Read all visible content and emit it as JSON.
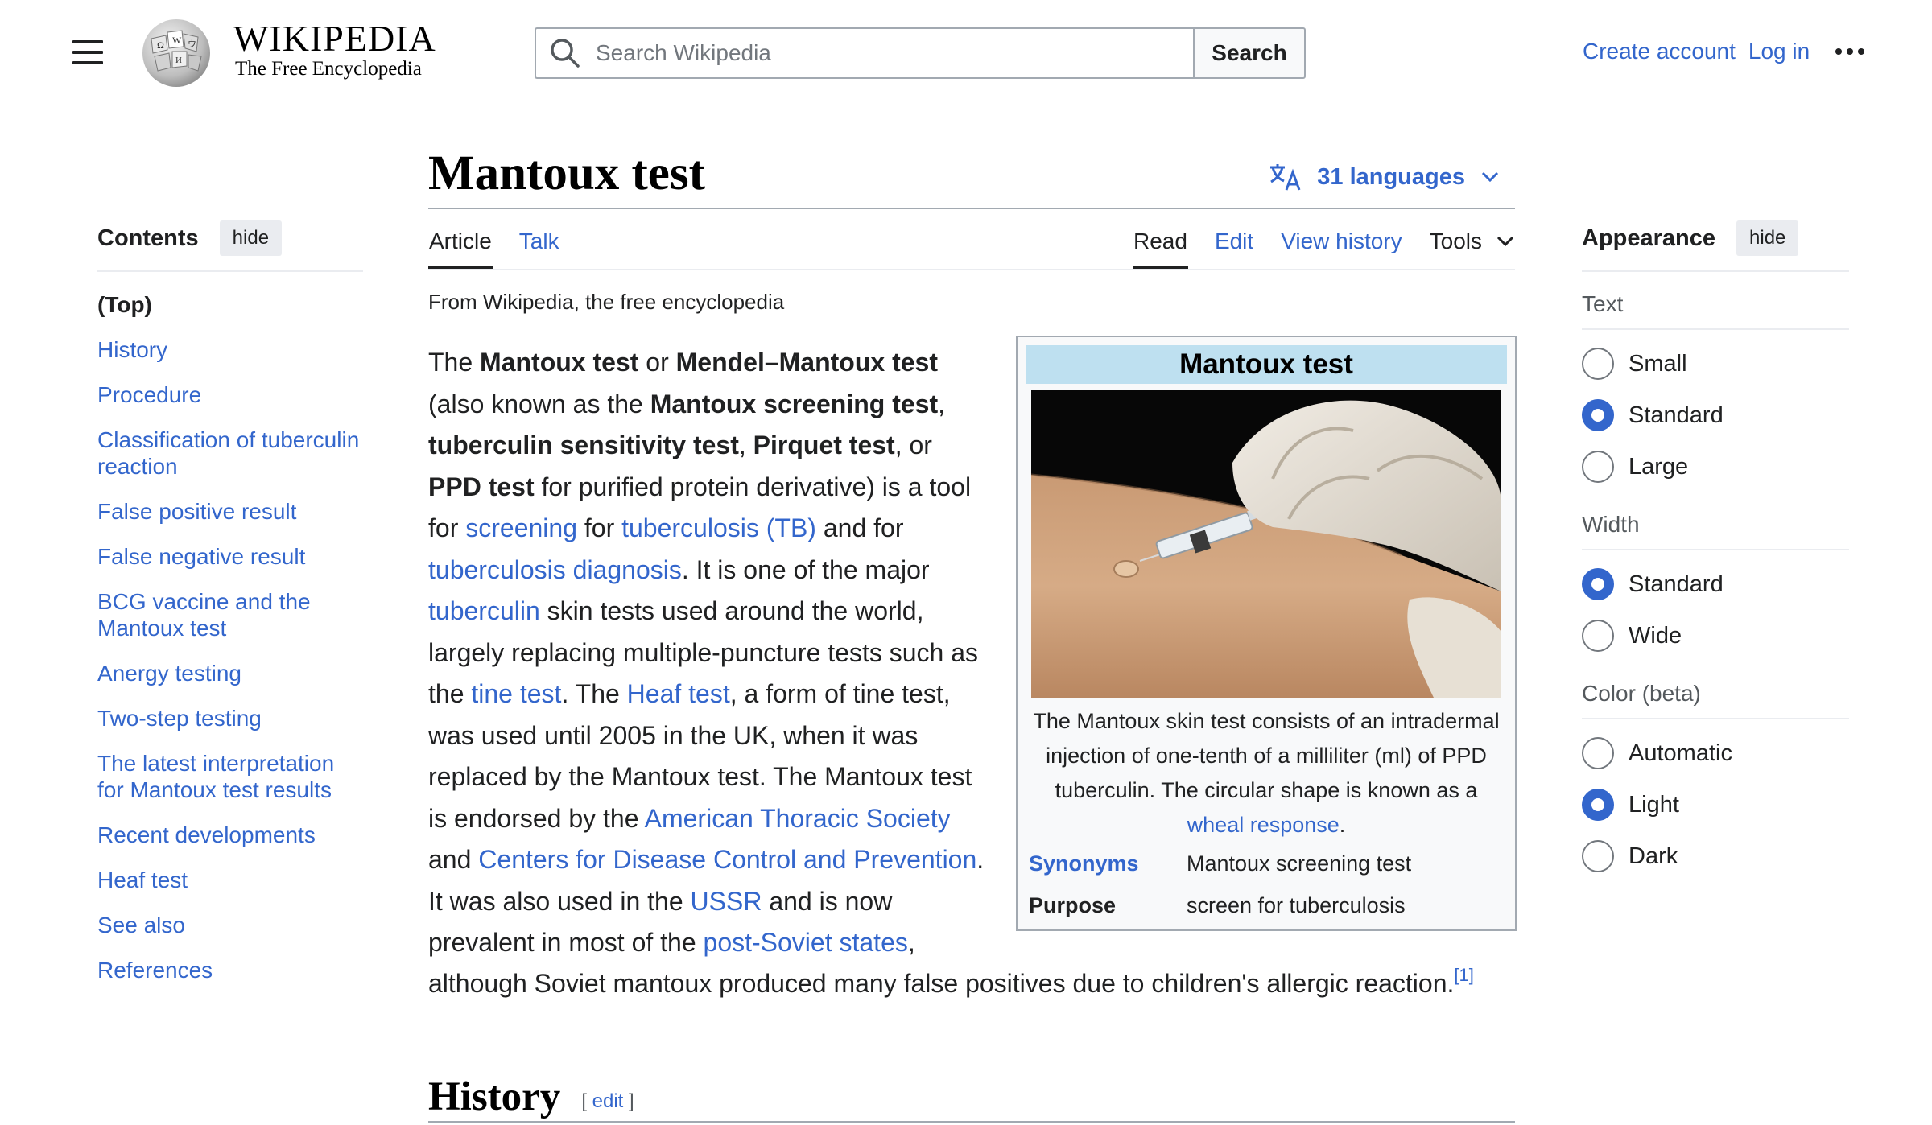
{
  "header": {
    "logo_title": "WIKIPEDIA",
    "logo_tagline": "The Free Encyclopedia",
    "search_placeholder": "Search Wikipedia",
    "search_button": "Search",
    "create_account": "Create account",
    "log_in": "Log in"
  },
  "toc": {
    "title": "Contents",
    "hide": "hide",
    "items": [
      "(Top)",
      "History",
      "Procedure",
      "Classification of tuberculin reaction",
      "False positive result",
      "False negative result",
      "BCG vaccine and the Mantoux test",
      "Anergy testing",
      "Two-step testing",
      "The latest interpretation for Mantoux test results",
      "Recent developments",
      "Heaf test",
      "See also",
      "References"
    ]
  },
  "page": {
    "title": "Mantoux test",
    "languages": "31 languages",
    "tabs": {
      "article": "Article",
      "talk": "Talk",
      "read": "Read",
      "edit": "Edit",
      "history": "View history",
      "tools": "Tools"
    },
    "tagline": "From Wikipedia, the free encyclopedia"
  },
  "intro": {
    "t1": "The ",
    "b1": "Mantoux test",
    "t2": " or ",
    "b2": "Mendel–Mantoux test",
    "t3": " (also known as the ",
    "b3": "Mantoux screening test",
    "t4": ", ",
    "b4": "tuberculin sensitivity test",
    "t5": ", ",
    "b5": "Pirquet test",
    "t6": ", or ",
    "b6": "PPD test",
    "t7": " for purified protein derivative) is a tool for ",
    "l1": "screening",
    "t8": " for ",
    "l2": "tuberculosis (TB)",
    "t9": " and for ",
    "l3": "tuberculosis diagnosis",
    "t10": ". It is one of the major ",
    "l4": "tuberculin",
    "t11": " skin tests used around the world, largely replacing multiple-puncture tests such as the ",
    "l5": "tine test",
    "t12": ". The ",
    "l6": "Heaf test",
    "t13": ", a form of tine test, was used until 2005 in the UK, when it was replaced by the Mantoux test. The Mantoux test is endorsed by the ",
    "l7": "American Thoracic Society",
    "t14": " and ",
    "l8": "Centers for Disease Control and Prevention",
    "t15": ". It was also used in the ",
    "l9": "USSR",
    "t16": " and is now prevalent in most of the ",
    "l10": "post-Soviet states",
    "t17": ",",
    "last": "although Soviet mantoux produced many false positives due to children's allergic reaction.",
    "ref": "[1]"
  },
  "infobox": {
    "title": "Mantoux test",
    "caption_text": "The Mantoux skin test consists of an intradermal injection of one-tenth of a milliliter (ml) of PPD tuberculin. The circular shape is known as a ",
    "caption_link": "wheal response",
    "caption_end": ".",
    "rows": [
      {
        "label": "Synonyms",
        "value": "Mantoux screening test"
      },
      {
        "label": "Purpose",
        "value": "screen for tuberculosis"
      }
    ]
  },
  "section": {
    "title": "History",
    "edit_open": "[ ",
    "edit": "edit",
    "edit_close": " ]"
  },
  "appearance": {
    "title": "Appearance",
    "hide": "hide",
    "groups": [
      {
        "label": "Text",
        "options": [
          "Small",
          "Standard",
          "Large"
        ],
        "selected": "Standard"
      },
      {
        "label": "Width",
        "options": [
          "Standard",
          "Wide"
        ],
        "selected": "Standard"
      },
      {
        "label": "Color (beta)",
        "options": [
          "Automatic",
          "Light",
          "Dark"
        ],
        "selected": "Light"
      }
    ]
  },
  "icons": {
    "menu": "hamburger-menu-icon",
    "search": "search-icon",
    "language": "translate-icon",
    "more": "ellipsis-icon",
    "chevron": "chevron-down-icon"
  },
  "colors": {
    "link": "#3366cc",
    "text": "#202122",
    "infobox_header": "#bee0f0",
    "border": "#a2a9b1"
  }
}
